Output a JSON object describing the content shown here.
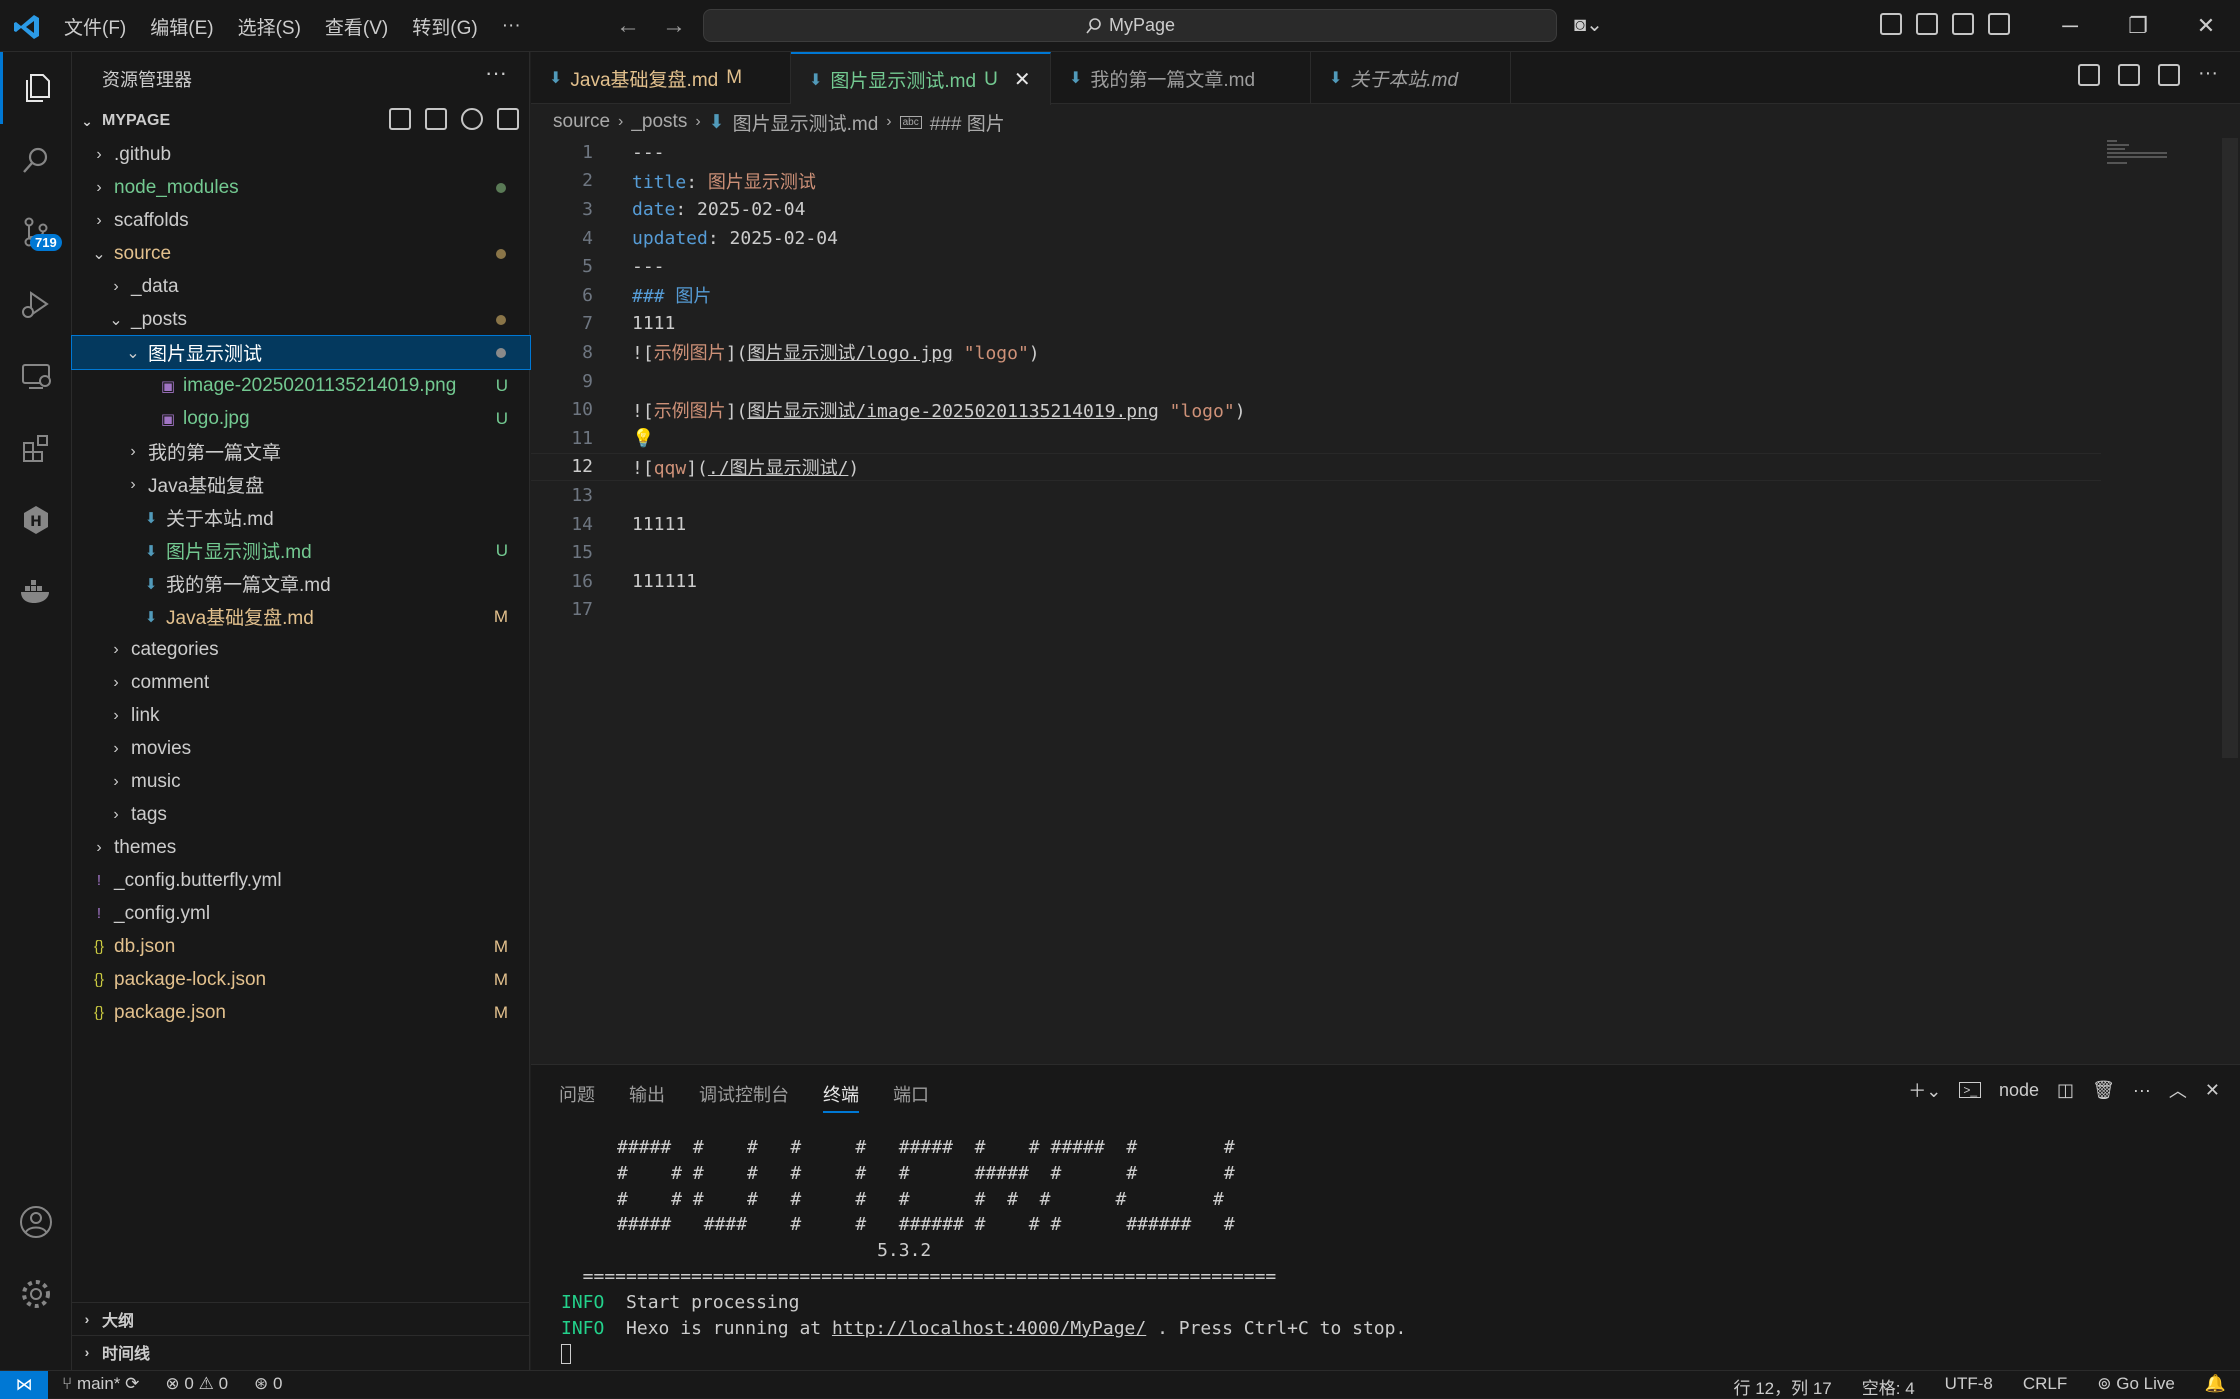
{
  "menu": [
    "文件(F)",
    "编辑(E)",
    "选择(S)",
    "查看(V)",
    "转到(G)",
    "···"
  ],
  "search": {
    "label": "MyPage"
  },
  "activity": {
    "scm_badge": "719"
  },
  "sidebar": {
    "title": "资源管理器",
    "section": "MYPAGE",
    "items": [
      {
        "label": ".github",
        "depth": 0,
        "type": "folder",
        "open": false
      },
      {
        "label": "node_modules",
        "depth": 0,
        "type": "folder",
        "open": false,
        "color": "green",
        "dot": "#5a7a56"
      },
      {
        "label": "scaffolds",
        "depth": 0,
        "type": "folder",
        "open": false
      },
      {
        "label": "source",
        "depth": 0,
        "type": "folder",
        "open": true,
        "color": "mod",
        "dot": "#8a7548"
      },
      {
        "label": "_data",
        "depth": 1,
        "type": "folder",
        "open": false
      },
      {
        "label": "_posts",
        "depth": 1,
        "type": "folder",
        "open": true,
        "dot": "#8a7548"
      },
      {
        "label": "图片显示测试",
        "depth": 2,
        "type": "folder",
        "open": true,
        "selected": true,
        "dot": "#8a8a8a"
      },
      {
        "label": "image-20250201135214019.png",
        "depth": 3,
        "type": "image",
        "color": "green",
        "status": "U"
      },
      {
        "label": "logo.jpg",
        "depth": 3,
        "type": "image",
        "color": "green",
        "status": "U"
      },
      {
        "label": "我的第一篇文章",
        "depth": 2,
        "type": "folder",
        "open": false
      },
      {
        "label": "Java基础复盘",
        "depth": 2,
        "type": "folder",
        "open": false
      },
      {
        "label": "关于本站.md",
        "depth": 2,
        "type": "md"
      },
      {
        "label": "图片显示测试.md",
        "depth": 2,
        "type": "md",
        "color": "green",
        "status": "U"
      },
      {
        "label": "我的第一篇文章.md",
        "depth": 2,
        "type": "md"
      },
      {
        "label": "Java基础复盘.md",
        "depth": 2,
        "type": "md",
        "color": "mod",
        "status": "M"
      },
      {
        "label": "categories",
        "depth": 1,
        "type": "folder",
        "open": false
      },
      {
        "label": "comment",
        "depth": 1,
        "type": "folder",
        "open": false
      },
      {
        "label": "link",
        "depth": 1,
        "type": "folder",
        "open": false
      },
      {
        "label": "movies",
        "depth": 1,
        "type": "folder",
        "open": false
      },
      {
        "label": "music",
        "depth": 1,
        "type": "folder",
        "open": false
      },
      {
        "label": "tags",
        "depth": 1,
        "type": "folder",
        "open": false
      },
      {
        "label": "themes",
        "depth": 0,
        "type": "folder",
        "open": false
      },
      {
        "label": "_config.butterfly.yml",
        "depth": 0,
        "type": "yml"
      },
      {
        "label": "_config.yml",
        "depth": 0,
        "type": "yml"
      },
      {
        "label": "db.json",
        "depth": 0,
        "type": "json",
        "color": "mod",
        "status": "M"
      },
      {
        "label": "package-lock.json",
        "depth": 0,
        "type": "json",
        "color": "mod",
        "status": "M"
      },
      {
        "label": "package.json",
        "depth": 0,
        "type": "json",
        "color": "mod",
        "status": "M"
      }
    ],
    "outline": "大纲",
    "timeline": "时间线"
  },
  "tabs": [
    {
      "label": "Java基础复盘.md",
      "status": "M",
      "color": "mod",
      "italic": false
    },
    {
      "label": "图片显示测试.md",
      "status": "U",
      "color": "green",
      "italic": false,
      "active": true
    },
    {
      "label": "我的第一篇文章.md",
      "status": "",
      "color": "",
      "italic": false
    },
    {
      "label": "关于本站.md",
      "status": "",
      "color": "",
      "italic": true
    }
  ],
  "breadcrumb": [
    "source",
    "_posts",
    "图片显示测试.md",
    "### 图片"
  ],
  "code": {
    "line_numbers": [
      "1",
      "2",
      "3",
      "4",
      "5",
      "6",
      "7",
      "8",
      "9",
      "10",
      "11",
      "12",
      "13",
      "14",
      "15",
      "16",
      "17"
    ],
    "current_line": 12,
    "l1": "---",
    "l2_key": "title",
    "l2_colon": ": ",
    "l2_val": "图片显示测试",
    "l3_key": "date",
    "l3_val": ": 2025-02-04",
    "l4_key": "updated",
    "l4_val": ": 2025-02-04",
    "l5": "---",
    "l6": "### 图片",
    "l7": "1111",
    "l8_a": "![",
    "l8_alt": "示例图片",
    "l8_b": "](",
    "l8_url": "图片显示测试/logo.jpg",
    "l8_c": " ",
    "l8_title": "\"logo\"",
    "l8_d": ")",
    "l10_a": "![",
    "l10_alt": "示例图片",
    "l10_b": "](",
    "l10_url": "图片显示测试/image-20250201135214019.png",
    "l10_c": " ",
    "l10_title": "\"logo\"",
    "l10_d": ")",
    "l12_a": "![",
    "l12_alt": "qqw",
    "l12_b": "](",
    "l12_url": "./图片显示测试/",
    "l12_d": ")",
    "l14": "11111",
    "l16": "111111"
  },
  "panel": {
    "tabs": [
      "问题",
      "输出",
      "调试控制台",
      "终端",
      "端口"
    ],
    "active_tab": "终端",
    "terminal_name": "node",
    "lines": [
      "#####  #    #   #     #   #####  #    # #####  #        #",
      "#    # #    #   #     #   #      #####  #      #        #",
      "#    # #    #   #     #   #      #  #  #      #        #",
      "#####   ####    #     #   ###### #    # #      ######   #",
      "                        5.3.2",
      "  ================================================================"
    ],
    "info_label": "INFO",
    "info1": "Start processing",
    "info2_a": "Hexo is running at ",
    "info2_link": "http://localhost:4000/MyPage/",
    "info2_b": " . Press Ctrl+C to stop."
  },
  "status": {
    "branch": "main*",
    "errors": "0",
    "warnings": "0",
    "ports": "0",
    "position": "行 12，列 17",
    "spaces": "空格: 4",
    "encoding": "UTF-8",
    "eol": "CRLF",
    "golive": "Go Live"
  }
}
